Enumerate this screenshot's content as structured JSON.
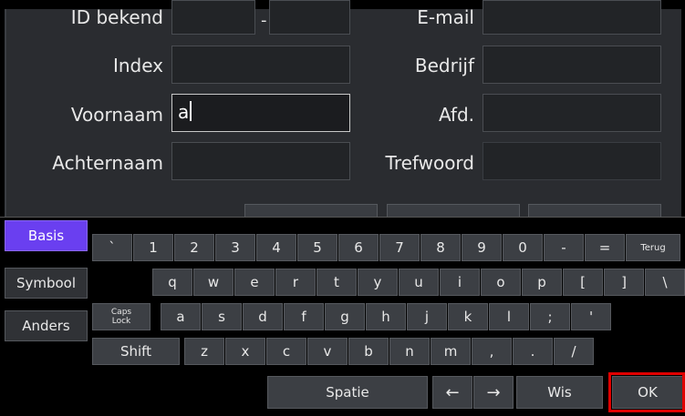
{
  "form": {
    "left": [
      {
        "label": "ID bekend",
        "value": "",
        "value2": "",
        "separator": "-"
      },
      {
        "label": "Index",
        "value": ""
      },
      {
        "label": "Voornaam",
        "value": "a"
      },
      {
        "label": "Achternaam",
        "value": ""
      }
    ],
    "right": [
      {
        "label": "E-mail",
        "value": ""
      },
      {
        "label": "Bedrijf",
        "value": ""
      },
      {
        "label": "Afd.",
        "value": ""
      },
      {
        "label": "Trefwoord",
        "value": ""
      }
    ]
  },
  "keyboard": {
    "modes": [
      "Basis",
      "Symbool",
      "Anders"
    ],
    "active_mode": "Basis",
    "row1": [
      "`",
      "1",
      "2",
      "3",
      "4",
      "5",
      "6",
      "7",
      "8",
      "9",
      "0",
      "-",
      "="
    ],
    "back_label": "Terug",
    "row2": [
      "q",
      "w",
      "e",
      "r",
      "t",
      "y",
      "u",
      "i",
      "o",
      "p",
      "[",
      "]",
      "\\"
    ],
    "caps_label_1": "Caps",
    "caps_label_2": "Lock",
    "row3": [
      "a",
      "s",
      "d",
      "f",
      "g",
      "h",
      "j",
      "k",
      "l",
      ";",
      "'"
    ],
    "shift_label": "Shift",
    "row4": [
      "z",
      "x",
      "c",
      "v",
      "b",
      "n",
      "m",
      ",",
      ".",
      "/"
    ],
    "space_label": "Spatie",
    "left_arrow": "←",
    "right_arrow": "→",
    "delete_label": "Wis",
    "ok_label": "OK"
  },
  "colors": {
    "active_mode": "#6a3ff0",
    "highlight": "#e00000"
  }
}
